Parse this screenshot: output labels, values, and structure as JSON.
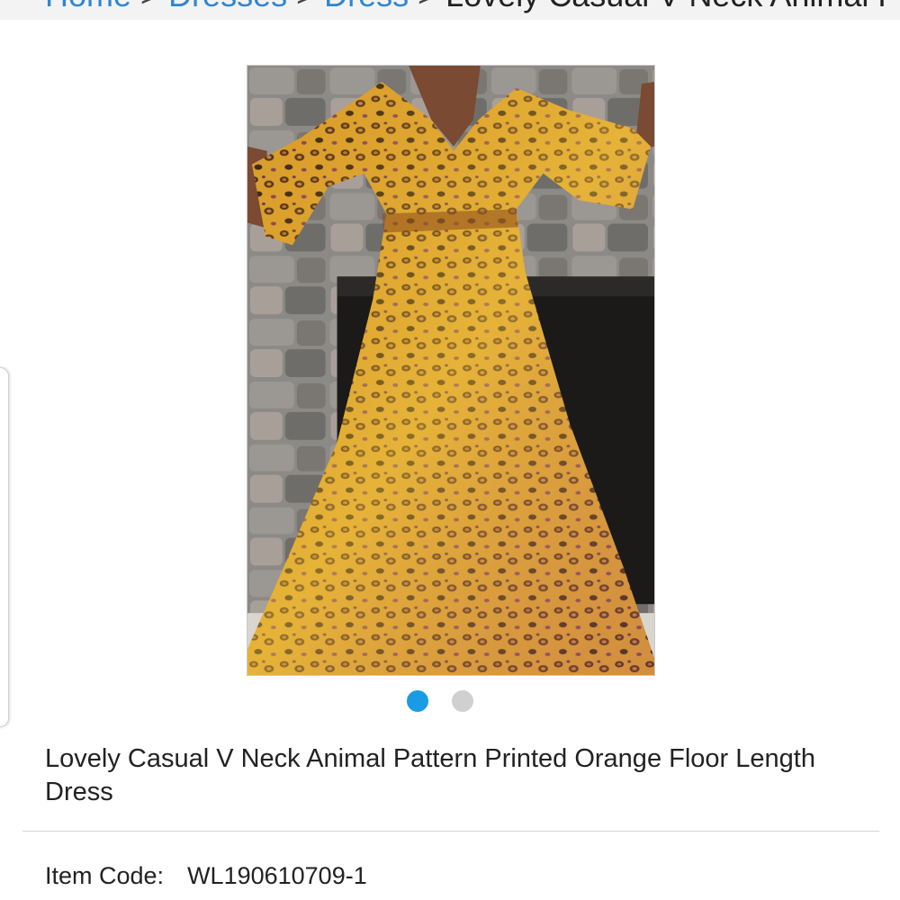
{
  "breadcrumb": {
    "items": [
      "Home",
      "Dresses",
      "Dress"
    ],
    "separator": ">",
    "current": "Lovely Casual V Neck Animal Patt..."
  },
  "product": {
    "image_alt": "Leopard print maxi dress",
    "title": "Lovely Casual V Neck Animal Pattern Printed Orange Floor Length Dress",
    "item_code_label": "Item Code:",
    "item_code_value": "WL190610709-1"
  },
  "carousel": {
    "slide_count": 2,
    "active_index": 0,
    "active_color": "#1a9be6",
    "inactive_color": "#d0d0d0"
  },
  "colors": {
    "link": "#2f86d0",
    "text": "#222222"
  }
}
